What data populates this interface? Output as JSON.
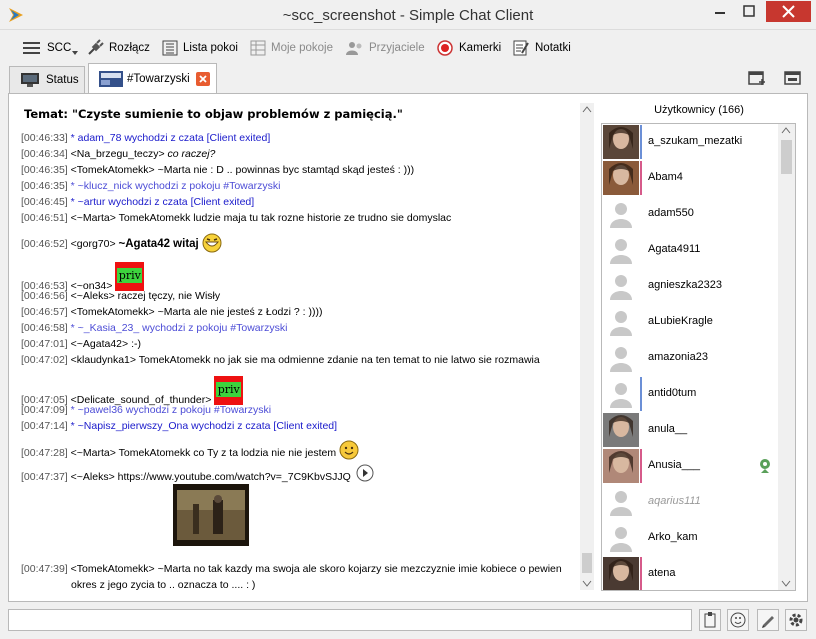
{
  "window": {
    "title": "~scc_screenshot - Simple Chat Client"
  },
  "toolbar": {
    "scc": "SCC",
    "disconnect": "Rozłącz",
    "rooms": "Lista pokoi",
    "my_rooms": "Moje pokoje",
    "friends": "Przyjaciele",
    "cams": "Kamerki",
    "notes": "Notatki"
  },
  "tabs": {
    "status": "Status",
    "room": "#Towarzyski"
  },
  "topic": "Temat: \"Czyste sumienie to objaw problemów z pamięcią.\"",
  "messages": [
    {
      "ts": "[00:46:33]",
      "text": "* adam_78 wychodzi z czata [Client exited]",
      "kind": "sys"
    },
    {
      "ts": "[00:46:34]",
      "text": "<Na_brzegu_teczy> ",
      "extra": "co raczej?",
      "kind": "italic"
    },
    {
      "ts": "[00:46:35]",
      "text": "<TomekAtomekk> ~Marta nie : D .. powinnas byc stamtąd skąd jesteś : )))",
      "kind": "normal"
    },
    {
      "ts": "[00:46:35]",
      "text": "* ~klucz_nick wychodzi z pokoju #Towarzyski",
      "kind": "join"
    },
    {
      "ts": "[00:46:45]",
      "text": "* ~artur wychodzi z czata [Client exited]",
      "kind": "sys"
    },
    {
      "ts": "[00:46:51]",
      "text": "<~Marta> TomekAtomekk ludzie maja tu tak rozne historie ze trudno sie domyslac",
      "kind": "normal"
    },
    {
      "ts": "[00:46:52]",
      "text": "<gorg70> ",
      "extra": "~Agata42 witaj",
      "kind": "bold"
    },
    {
      "ts": "[00:46:53]",
      "text": "<~on34> ",
      "kind": "normal"
    },
    {
      "ts": "[00:46:56]",
      "text": "<~Aleks> raczej tęczy, nie Wisły",
      "kind": "normal"
    },
    {
      "ts": "[00:46:57]",
      "text": "<TomekAtomekk> ~Marta  ale nie jesteś z Łodzi ? : ))))",
      "kind": "normal"
    },
    {
      "ts": "[00:46:58]",
      "text": "* ~_Kasia_23_ wychodzi z pokoju #Towarzyski",
      "kind": "join"
    },
    {
      "ts": "[00:47:01]",
      "text": "<~Agata42> :-)",
      "kind": "normal"
    },
    {
      "ts": "[00:47:02]",
      "text": "<klaudynka1> TomekAtomekk  no jak sie ma odmienne zdanie na ten temat to nie latwo sie rozmawia",
      "kind": "normal"
    },
    {
      "ts": "[00:47:05]",
      "text": "<Delicate_sound_of_thunder> ",
      "kind": "normal"
    },
    {
      "ts": "[00:47:09]",
      "text": "* ~pawel36 wychodzi z pokoju #Towarzyski",
      "kind": "join"
    },
    {
      "ts": "[00:47:14]",
      "text": "* ~Napisz_pierwszy_Ona wychodzi z czata [Client exited]",
      "kind": "sys"
    },
    {
      "ts": "[00:47:28]",
      "text": "<~Marta> TomekAtomekk co Ty z ta lodzia nie nie jestem",
      "kind": "normal"
    },
    {
      "ts": "[00:47:37]",
      "text": "<~Aleks> https://www.youtube.com/watch?v=_7C9KbvSJJQ",
      "kind": "normal"
    },
    {
      "ts": "[00:47:39]",
      "text": "<TomekAtomekk> ~Marta  no tak kazdy ma swoja ale skoro kojarzy sie mezczyznie imie kobiece o pewien",
      "kind": "normal"
    },
    {
      "ts": "",
      "text": "okres z jego zycia to .. oznacza to .... : )",
      "kind": "normal"
    }
  ],
  "priv_label": "priv",
  "users_title": "Użytkownicy (166)",
  "users": [
    {
      "name": "a_szukam_mezatki",
      "bar": "#6b8fd6",
      "photo": true,
      "tone": "#5a4638"
    },
    {
      "name": "Abam4",
      "bar": "#d65a8a",
      "photo": true,
      "tone": "#8a5a3a"
    },
    {
      "name": "adam550",
      "bar": "",
      "photo": false
    },
    {
      "name": "Agata4911",
      "bar": "",
      "photo": false
    },
    {
      "name": "agnieszka2323",
      "bar": "",
      "photo": false
    },
    {
      "name": "aLubieKragle",
      "bar": "",
      "photo": false
    },
    {
      "name": "amazonia23",
      "bar": "",
      "photo": false
    },
    {
      "name": "antid0tum",
      "bar": "#6b8fd6",
      "photo": false
    },
    {
      "name": "anula__",
      "bar": "",
      "photo": true,
      "tone": "#7a7a7a"
    },
    {
      "name": "Anusia___",
      "bar": "#d65a8a",
      "photo": true,
      "tone": "#b08878",
      "cam": true
    },
    {
      "name": "aqarius111",
      "bar": "",
      "photo": false,
      "italic": true
    },
    {
      "name": "Arko_kam",
      "bar": "",
      "photo": false
    },
    {
      "name": "atena",
      "bar": "#d65a8a",
      "photo": true,
      "tone": "#4a3a32"
    }
  ]
}
